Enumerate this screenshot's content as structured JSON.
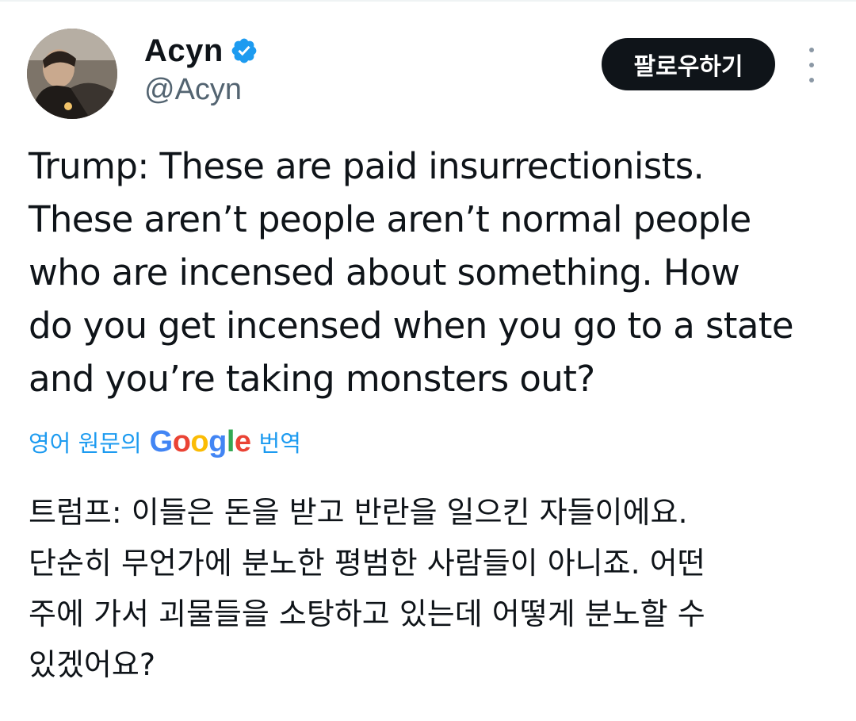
{
  "author": {
    "display_name": "Acyn",
    "handle": "@Acyn",
    "verified": true
  },
  "actions": {
    "follow_label": "팔로우하기",
    "more_icon": "more-vertical-icon"
  },
  "tweet": {
    "text": "Trump: These are paid insurrectionists.\nThese aren’t people aren’t normal people\nwho are incensed about something. How\ndo you get incensed when you go to a state\nand you’re taking monsters out?"
  },
  "translation": {
    "prefix": "영어 원문의",
    "provider_letters": [
      "G",
      "o",
      "o",
      "g",
      "l",
      "e"
    ],
    "suffix": "번역",
    "text": "트럼프: 이들은 돈을 받고 반란을 일으킨 자들이에요.\n단순히 무언가에 분노한 평범한 사람들이 아니죠. 어떤\n주에 가서 괴물들을 소탕하고 있는데 어떻게 분노할 수\n있겠어요?"
  },
  "colors": {
    "text": "#0f1419",
    "secondary": "#536471",
    "link": "#1d9bf0",
    "verified": "#1d9bf0",
    "follow_bg": "#0f1419"
  }
}
